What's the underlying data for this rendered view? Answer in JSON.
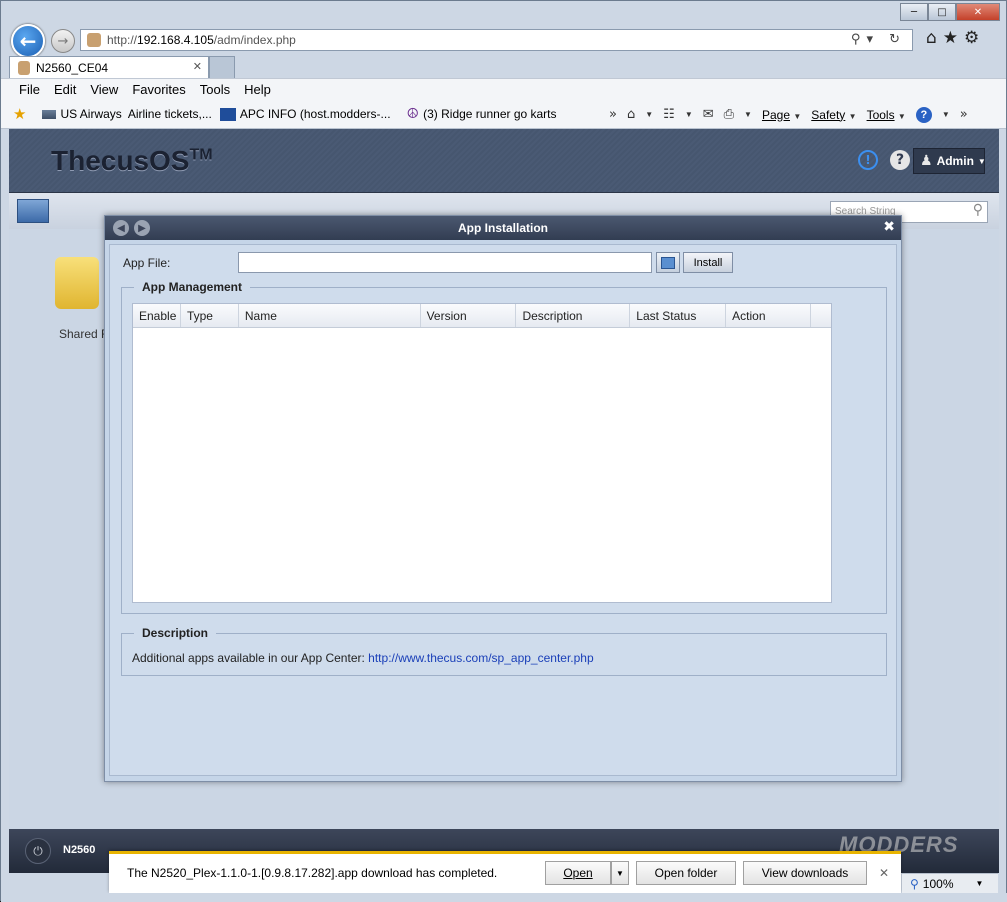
{
  "browser": {
    "address": {
      "scheme": "http://",
      "host": "192.168.4.105",
      "path": "/adm/index.php"
    },
    "tab_title": "N2560_CE04",
    "menu": [
      "File",
      "Edit",
      "View",
      "Favorites",
      "Tools",
      "Help"
    ],
    "favorites": [
      {
        "label": "US Airways",
        "icon": "page-icon"
      },
      {
        "label": "Airline tickets,...",
        "icon": ""
      },
      {
        "label": "APC INFO (host.modders-...",
        "icon": "mi-icon"
      },
      {
        "label": "(3) Ridge runner go karts",
        "icon": "peace-icon"
      }
    ],
    "command_bar": {
      "page": "Page",
      "safety": "Safety",
      "tools": "Tools"
    },
    "zoom": "100%"
  },
  "os": {
    "logo": "ThecusOS",
    "logo_tm": "TM",
    "admin_label": "Admin",
    "search_placeholder": "Search String",
    "desktop_icon_label": "Shared F",
    "taskbar_label": "N2560"
  },
  "dialog": {
    "title": "App Installation",
    "app_file_label": "App File:",
    "install_label": "Install",
    "app_management": {
      "legend": "App Management",
      "columns": [
        "Enable",
        "Type",
        "Name",
        "Version",
        "Description",
        "Last Status",
        "Action"
      ],
      "rows": []
    },
    "description": {
      "legend": "Description",
      "text": "Additional apps available in our App Center:",
      "link": "http://www.thecus.com/sp_app_center.php"
    }
  },
  "download_bar": {
    "message": "The N2520_Plex-1.1.0-1.[0.9.8.17.282].app download has completed.",
    "open": "Open",
    "open_folder": "Open folder",
    "view_downloads": "View downloads"
  },
  "watermark": "MODDERS"
}
